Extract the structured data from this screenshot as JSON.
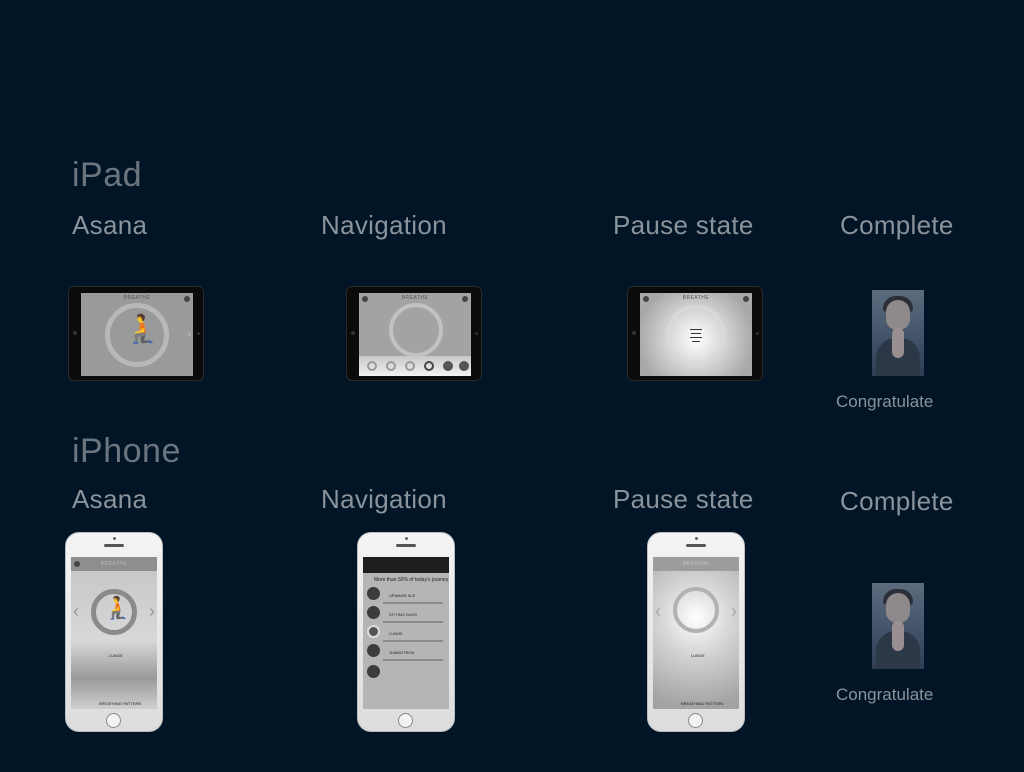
{
  "sections": {
    "ipad": "iPad",
    "iphone": "iPhone"
  },
  "columns": {
    "asana": "Asana",
    "navigation": "Navigation",
    "pause": "Pause state",
    "complete": "Complete"
  },
  "captions": {
    "congratulate": "Congratulate"
  },
  "screens": {
    "breathe": "BREATHE",
    "nav_header": "More than 50% of today's journey",
    "poses": [
      "UPWARD SLE",
      "SITTING DUCK",
      "LUNGE",
      "JUMBOTRON"
    ],
    "lunge": "LUNGE",
    "breathing_pattern": "BREATHING PATTERN"
  },
  "icons": {
    "figure": "kneeling-figure-icon",
    "photo": "woman-praying-photo"
  },
  "colors": {
    "background": "#021526",
    "section_text": "#6b7580",
    "column_text": "#8a939c"
  }
}
